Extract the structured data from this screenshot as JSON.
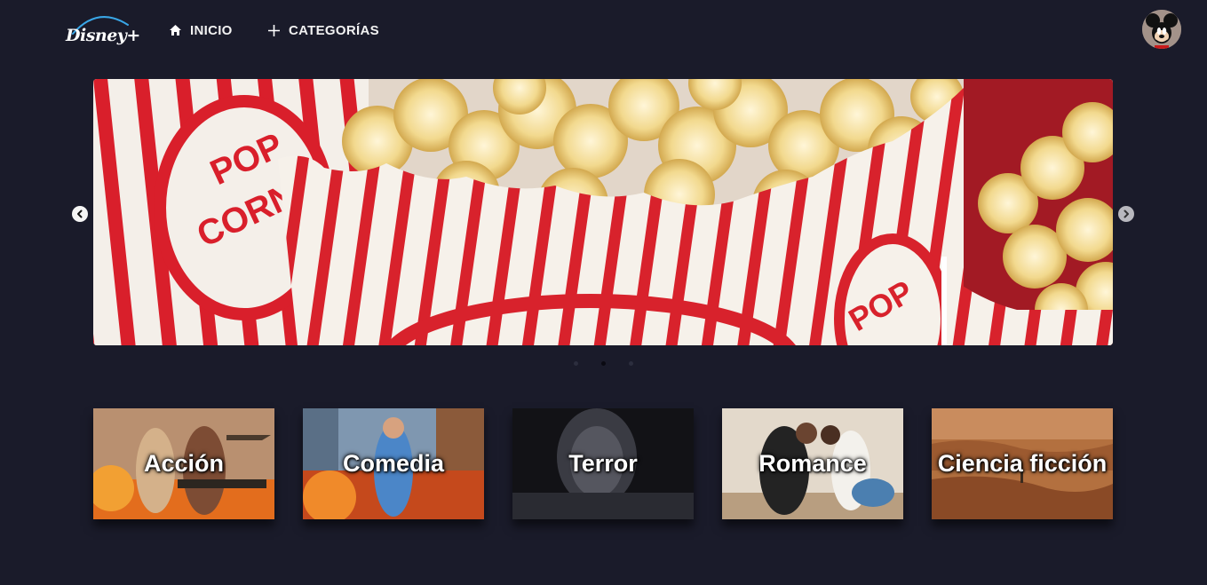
{
  "header": {
    "logo_text": "Disney+",
    "nav": [
      {
        "label": "INICIO",
        "icon": "home-icon"
      },
      {
        "label": "CATEGORÍAS",
        "icon": "plus-icon"
      }
    ],
    "avatar": "mickey-avatar"
  },
  "carousel": {
    "image": "popcorn-boxes",
    "prev_icon": "chevron-left-icon",
    "next_icon": "chevron-right-icon",
    "slide_count": 3,
    "active_slide": 2
  },
  "categories": [
    {
      "label": "Acción"
    },
    {
      "label": "Comedia"
    },
    {
      "label": "Terror"
    },
    {
      "label": "Romance"
    },
    {
      "label": "Ciencia ficción"
    }
  ],
  "colors": {
    "background": "#1a1b2a",
    "accent_red": "#d8232a",
    "popcorn": "#f3dc9a"
  }
}
